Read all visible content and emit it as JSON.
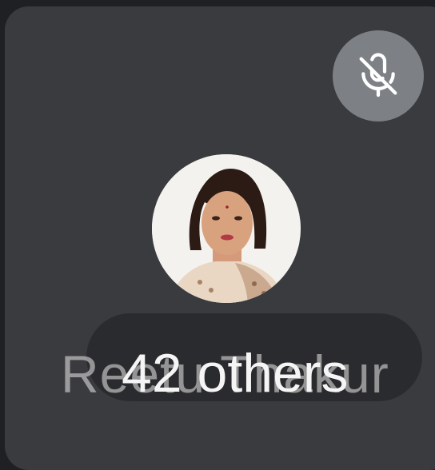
{
  "tile": {
    "participant_name": "Reetu Thakur",
    "others_label": "42 others",
    "mic_state": "muted",
    "mic_icon": "mic-off-icon",
    "avatar": "participant-avatar"
  },
  "colors": {
    "background": "#1f2023",
    "tile": "#3a3b3e",
    "mute_button": "#7d8185",
    "label_pill": "#2a2b2e",
    "text": "#f5f5f5"
  }
}
